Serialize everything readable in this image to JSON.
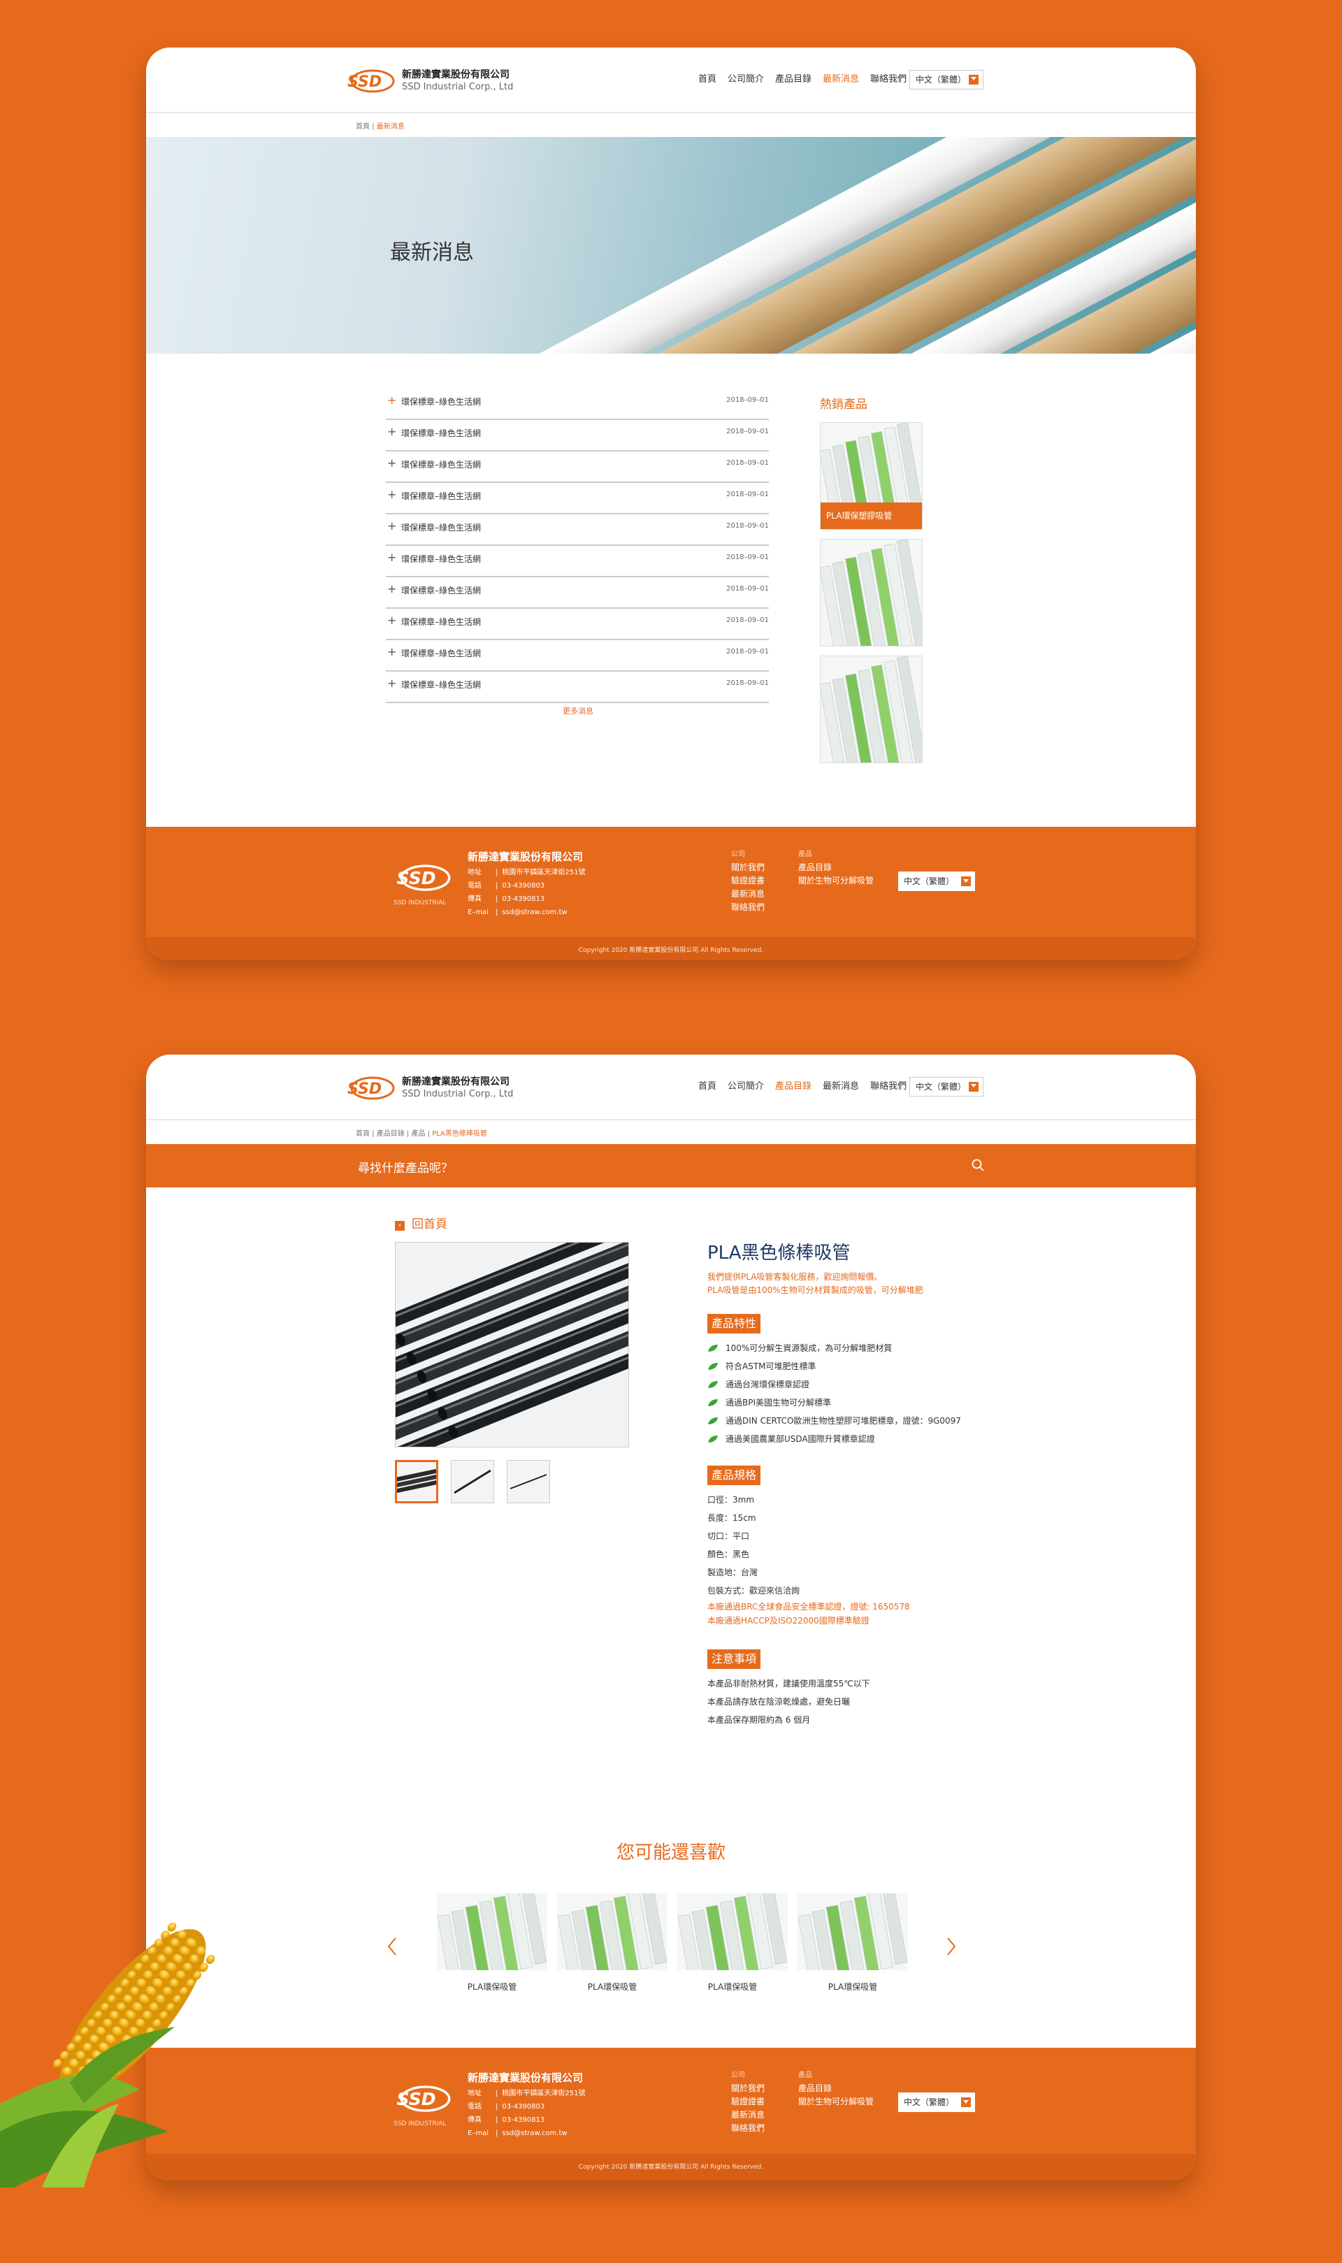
{
  "colors": {
    "accent": "#e66a1c",
    "navy": "#1e3a66",
    "leaf": "#3aa534"
  },
  "brand": {
    "name": "新勝達實業股份有限公司",
    "name_en": "SSD Industrial Corp., Ltd"
  },
  "nav": [
    "首頁",
    "公司簡介",
    "產品目錄",
    "最新消息",
    "聯絡我們"
  ],
  "lang": "中文（繁體）",
  "page1": {
    "breadcrumb": [
      "首頁",
      "最新消息"
    ],
    "banner_title": "最新消息",
    "news": [
      {
        "title": "環保標章–綠色生活網",
        "date": "2018–09–01"
      },
      {
        "title": "環保標章–綠色生活網",
        "date": "2018–09–01"
      },
      {
        "title": "環保標章–綠色生活網",
        "date": "2018–09–01"
      },
      {
        "title": "環保標章–綠色生活網",
        "date": "2018–09–01"
      },
      {
        "title": "環保標章–綠色生活網",
        "date": "2018–09–01"
      },
      {
        "title": "環保標章–綠色生活網",
        "date": "2018–09–01"
      },
      {
        "title": "環保標章–綠色生活網",
        "date": "2018–09–01"
      },
      {
        "title": "環保標章–綠色生活網",
        "date": "2018–09–01"
      },
      {
        "title": "環保標章–綠色生活網",
        "date": "2018–09–01"
      },
      {
        "title": "環保標章–綠色生活網",
        "date": "2018–09–01"
      }
    ],
    "more": "更多消息",
    "hot_title": "熱銷產品",
    "hot_caption": "PLA環保塑膠吸管"
  },
  "footer": {
    "company": "新勝達實業股份有限公司",
    "logo_sub": "SSD INDUSTRIAL",
    "info": [
      {
        "label": "地址",
        "value": "桃園市平鎮區天津街251號"
      },
      {
        "label": "電話",
        "value": "03-4390803"
      },
      {
        "label": "傳真",
        "value": "03-4390813"
      },
      {
        "label": "E–mai",
        "value": "ssd@straw.com.tw"
      }
    ],
    "col1_head": "公司",
    "col1": [
      "關於我們",
      "驗證證書",
      "最新消息",
      "聯絡我們"
    ],
    "col2_head": "產品",
    "col2": [
      "產品目錄",
      "關於生物可分解吸管"
    ],
    "copyright": "Copyright 2020 新勝達實業股份有限公司 All Rights Reserved."
  },
  "page2": {
    "breadcrumb": [
      "首頁",
      "產品目錄",
      "產品",
      "PLA黑色條棒吸管"
    ],
    "search_placeholder": "尋找什麼產品呢？",
    "back": "回首頁",
    "product_title": "PLA黑色條棒吸管",
    "desc": [
      "我們提供PLA吸管客製化服務，歡迎詢問報價。",
      "PLA吸管是由100%生物可分材質製成的吸管，可分解堆肥"
    ],
    "features_head": "產品特性",
    "features": [
      "100%可分解生資源製成，為可分解堆肥材質",
      "符合ASTM可堆肥性標準",
      "通過台灣環保標章認證",
      "通過BPI美國生物可分解標準",
      "通過DIN CERTCO歐洲生物性塑膠可堆肥標章，證號：9G0097",
      "通過美國農業部USDA國際升質標章認證"
    ],
    "specs_head": "產品規格",
    "specs": [
      "口徑：3mm",
      "長度：15cm",
      "切口：平口",
      "顏色：黑色",
      "製造地：台灣",
      "包裝方式：歡迎來信洽詢"
    ],
    "spec_notes": [
      "本廠通過BRC全球食品安全標準認證，證號: 1650578",
      "本廠通過HACCP及ISO22000國際標準驗證"
    ],
    "notes_head": "注意事項",
    "notes": [
      "本產品非耐熱材質，建議使用溫度55℃以下",
      "本產品請存放在陰涼乾燥處，避免日曬",
      "本產品保存期限約為 6 個月"
    ],
    "like_title": "您可能還喜歡",
    "like_items": [
      "PLA環保吸管",
      "PLA環保吸管",
      "PLA環保吸管",
      "PLA環保吸管"
    ]
  }
}
